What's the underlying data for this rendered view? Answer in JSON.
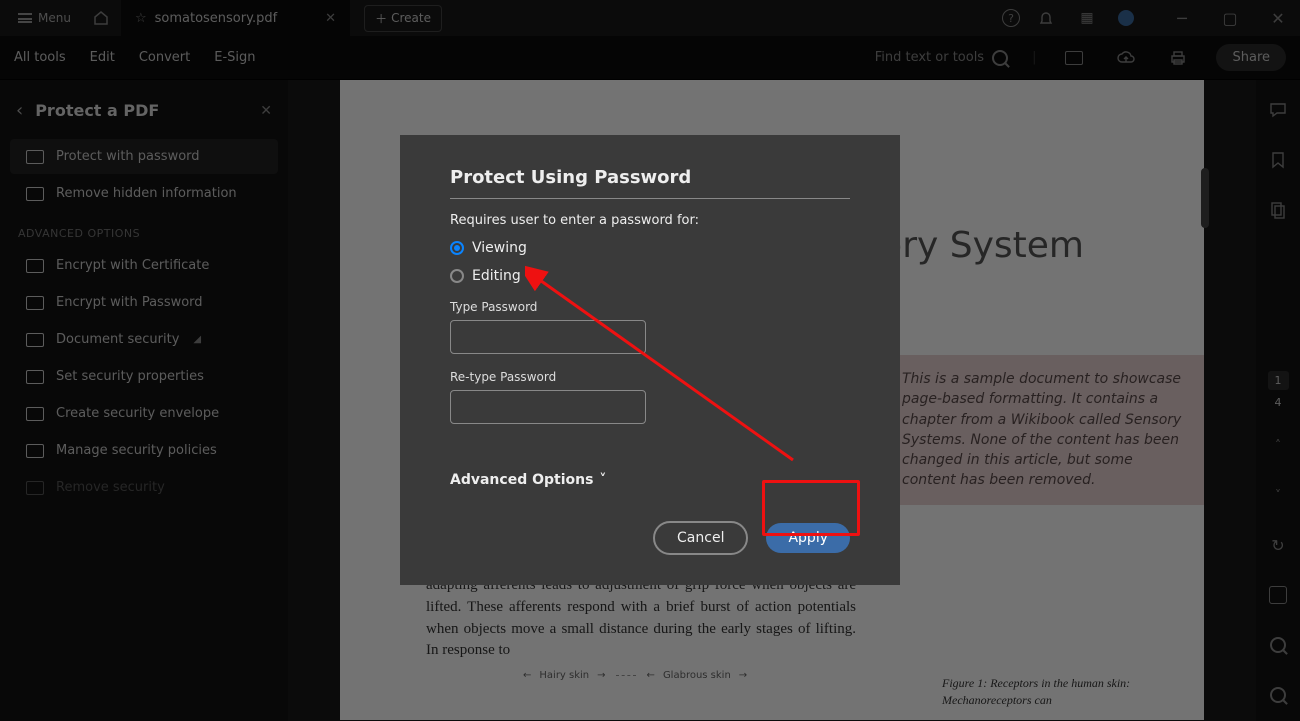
{
  "titlebar": {
    "menu_label": "Menu",
    "tab_title": "somatosensory.pdf",
    "create_label": "Create"
  },
  "toolbar": {
    "items": [
      "All tools",
      "Edit",
      "Convert",
      "E-Sign"
    ],
    "find_placeholder": "Find text or tools",
    "share_label": "Share"
  },
  "sidebar": {
    "title": "Protect a PDF",
    "items": [
      "Protect with password",
      "Remove hidden information"
    ],
    "group_label": "ADVANCED OPTIONS",
    "adv_items": [
      "Encrypt with Certificate",
      "Encrypt with Password",
      "Document security",
      "Set security properties",
      "Create security envelope",
      "Manage security policies",
      "Remove security"
    ]
  },
  "document": {
    "title_fragment": "sory System",
    "callout": "This is a sample document to showcase page-based formatting. It contains a chapter from a Wikibook called Sensory Systems. None of the content has been changed in this article, but some content has been removed.",
    "body": "adapting afferents leads to adjustment of grip force when objects are lifted. These afferents respond with a brief burst of action potentials when objects move a small distance during the early stages of lifting. In response to",
    "fig_labels": {
      "hairy": "Hairy skin",
      "glabrous": "Glabrous skin"
    },
    "fig_caption": "Figure 1:  Receptors in the human skin: Mechanoreceptors can"
  },
  "dialog": {
    "title": "Protect Using Password",
    "subtitle": "Requires user to enter a password for:",
    "option_viewing": "Viewing",
    "option_editing": "Editing",
    "type_label": "Type Password",
    "retype_label": "Re-type Password",
    "advanced_label": "Advanced Options",
    "cancel": "Cancel",
    "apply": "Apply"
  },
  "page_nav": {
    "current": "1",
    "total": "4"
  }
}
